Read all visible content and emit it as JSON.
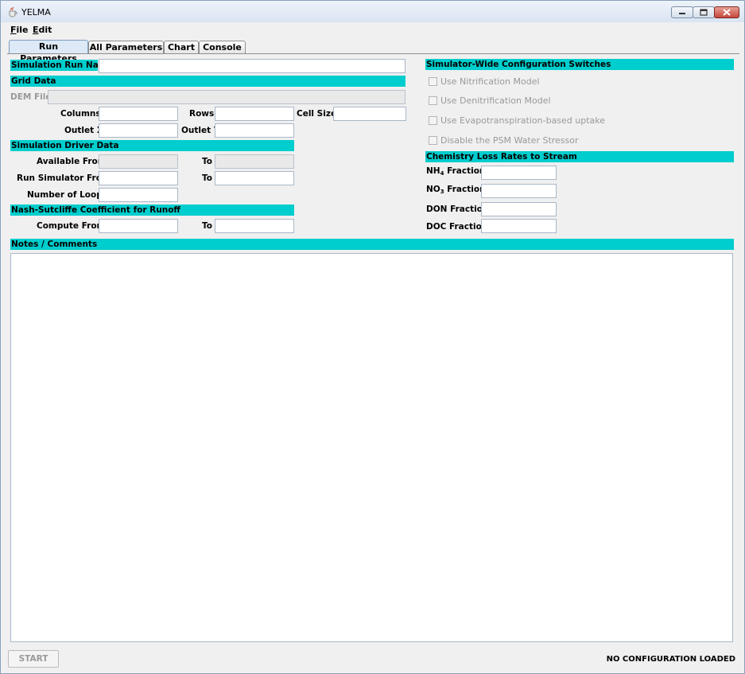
{
  "window": {
    "title": "YELMA",
    "icon": "java-cup-icon",
    "controls": [
      "minimize-icon",
      "maximize-icon",
      "close-icon"
    ]
  },
  "menu": [
    {
      "label": "File",
      "mnemonic": "F"
    },
    {
      "label": "Edit",
      "mnemonic": "E"
    }
  ],
  "tabs": [
    "Run Parameters",
    "All Parameters",
    "Chart",
    "Console"
  ],
  "active_tab": "Run Parameters",
  "run_name": {
    "label": "Simulation Run Name",
    "value": ""
  },
  "grid_data": {
    "header": "Grid Data",
    "dem_file_label": "DEM File",
    "columns_label": "Columns",
    "rows_label": "Rows",
    "cell_size_label": "Cell Size",
    "outlet_x_label": "Outlet X",
    "outlet_y_label": "Outlet Y"
  },
  "driver_data": {
    "header": "Simulation Driver Data",
    "available_from_label": "Available From",
    "to_label": "To",
    "run_from_label": "Run Simulator From",
    "loops_label": "Number of Loops"
  },
  "nash": {
    "header": "Nash-Sutcliffe Coefficient for Runoff",
    "compute_from_label": "Compute From",
    "to_label": "To"
  },
  "switches": {
    "header": "Simulator-Wide Configuration Switches",
    "items": [
      {
        "label": "Use Nitrification Model",
        "checked": false,
        "enabled": false
      },
      {
        "label": "Use Denitrification Model",
        "checked": false,
        "enabled": false
      },
      {
        "label": "Use Evapotranspiration-based uptake",
        "checked": false,
        "enabled": false
      },
      {
        "label": "Disable the PSM Water Stressor",
        "checked": false,
        "enabled": false
      }
    ]
  },
  "chemistry": {
    "header": "Chemistry Loss Rates to Stream",
    "nh4_main": "NH",
    "nh4_sub": "4",
    "nh4_tail": " Fraction",
    "no3_main": "NO",
    "no3_sub": "3",
    "no3_tail": " Fraction",
    "don_label": "DON Fraction",
    "doc_label": "DOC Fraction"
  },
  "notes": {
    "header": "Notes / Comments",
    "value": ""
  },
  "footer": {
    "start_label": "START",
    "start_enabled": false,
    "status": "NO CONFIGURATION LOADED"
  },
  "colors": {
    "section_header": "#00cdcd",
    "disabled_text": "#999999"
  }
}
